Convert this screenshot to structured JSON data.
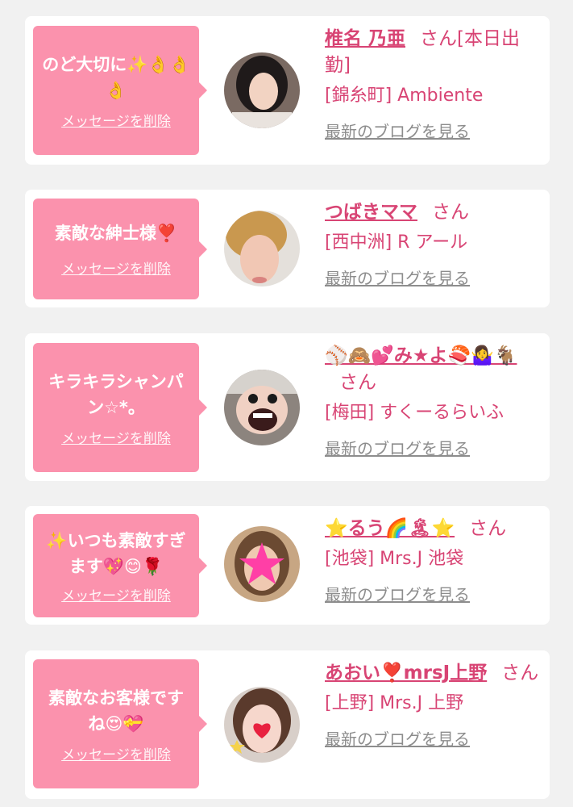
{
  "cards": [
    {
      "message": "のど大切に✨👌👌👌",
      "delete_label": "メッセージを削除",
      "name": "椎名 乃亜",
      "honorific": "さん[本日出勤]",
      "shop": "[錦糸町] Ambiente",
      "blog_label": "最新のブログを見る"
    },
    {
      "message": "素敵な紳士様❣️",
      "delete_label": "メッセージを削除",
      "name": "つばきママ",
      "honorific": "さん",
      "shop": "[西中洲] R アール",
      "blog_label": "最新のブログを見る"
    },
    {
      "message": "キラキラシャンパン☆*。",
      "delete_label": "メッセージを削除",
      "name": "⚾🙈💕み★よ🍣🤷‍♀️🐐",
      "honorific": "さん",
      "shop": "[梅田] すくーるらいふ",
      "blog_label": "最新のブログを見る"
    },
    {
      "message": "✨いつも素敵すぎます💖😊🌹",
      "delete_label": "メッセージを削除",
      "name": "⭐るう🌈🏝⭐",
      "honorific": "さん",
      "shop": "[池袋] Mrs.J 池袋",
      "blog_label": "最新のブログを見る"
    },
    {
      "message": "素敵なお客様ですね😍💝",
      "delete_label": "メッセージを削除",
      "name": "あおい❣️mrsJ上野",
      "honorific": "さん",
      "shop": "[上野] Mrs.J 上野",
      "blog_label": "最新のブログを見る"
    }
  ],
  "colors": {
    "bubble": "#fb92ad",
    "accent": "#d84474",
    "link_gray": "#8d8d8d",
    "background": "#f1f1f1"
  }
}
